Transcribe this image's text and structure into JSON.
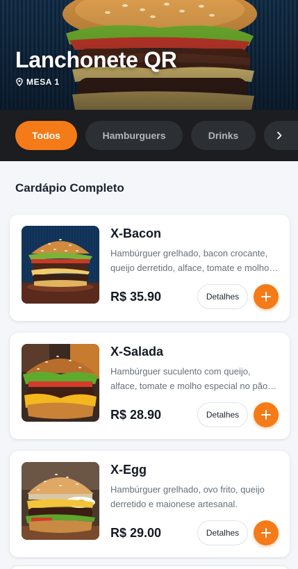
{
  "header": {
    "title": "Lanchonete QR",
    "table_label": "MESA 1",
    "location_icon": "map-pin-icon"
  },
  "categories": {
    "items": [
      {
        "label": "Todos",
        "active": true
      },
      {
        "label": "Hamburguers",
        "active": false
      },
      {
        "label": "Drinks",
        "active": false
      },
      {
        "label": "",
        "active": false
      }
    ],
    "scroll_icon": "chevron-right-icon"
  },
  "section": {
    "title": "Cardápio Completo"
  },
  "menu": {
    "items": [
      {
        "name": "X-Bacon",
        "description": "Hambúrguer grelhado, bacon crocante, queijo derretido, alface, tomate e molho especial",
        "price": "R$ 35.90",
        "details_label": "Detalhes"
      },
      {
        "name": "X-Salada",
        "description": "Hambúrguer suculento com queijo, alface, tomate e molho especial no pão brioche",
        "price": "R$ 28.90",
        "details_label": "Detalhes"
      },
      {
        "name": "X-Egg",
        "description": "Hambúrguer grelhado, ovo frito, queijo derretido e maionese artesanal.",
        "price": "R$ 29.00",
        "details_label": "Detalhes"
      }
    ],
    "add_icon": "plus-icon"
  },
  "colors": {
    "accent": "#f57a18",
    "category_bar": "#1b1d20",
    "chip_inactive": "#2c2f33",
    "page_background": "#f4f6f9",
    "text_dark": "#141a24",
    "text_muted": "#66707c"
  }
}
